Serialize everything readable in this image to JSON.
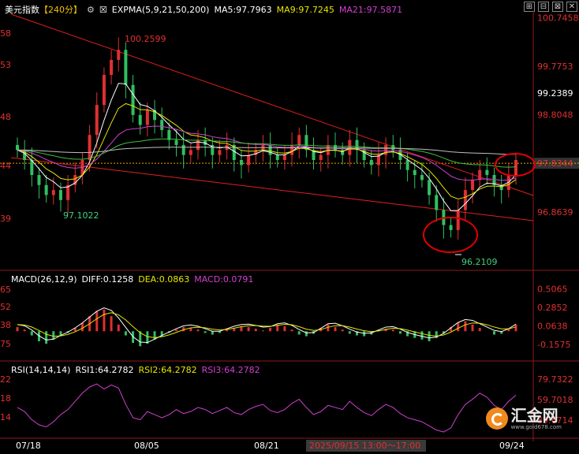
{
  "header_main": {
    "symbol": "美元指数",
    "period": "【240分】",
    "expma_label": "EXPMA(5,9,21,50,200)",
    "ma5": "MA5:97.7963",
    "ma9": "MA9:97.7245",
    "ma21": "MA21:97.5871"
  },
  "header_macd": {
    "label": "MACD(26,12,9)",
    "diff": "DIFF:0.1258",
    "dea": "DEA:0.0863",
    "macd": "MACD:0.0791"
  },
  "header_rsi": {
    "label": "RSI(14,14,14)",
    "rsi1": "RSI1:64.2782",
    "rsi2": "RSI2:64.2782",
    "rsi3": "RSI3:64.2782"
  },
  "window_buttons": [
    "⊞",
    "⊟",
    "⊠",
    "✕"
  ],
  "colors": {
    "ma5": "#ffffff",
    "ma9": "#e6e600",
    "ma21": "#d040d0",
    "ma50": "#40c040",
    "ma200": "#c0c0c0",
    "up": "#e03030",
    "down": "#30c060",
    "trend": "#e02020",
    "price_line": "#f0a000",
    "axis_text_red": "#e03030",
    "axis_text_white": "#ffffff",
    "low_label": "#40d080"
  },
  "watermark": {
    "brand": "汇金网",
    "url": "www.gold678.com"
  },
  "chart_data": [
    {
      "type": "candlestick",
      "title": "美元指数",
      "right_axis_labels": [
        "100.7458",
        "99.7753",
        "99.2389",
        "98.8048",
        "97.8344",
        "96.8639"
      ],
      "left_axis_labels": [
        "58",
        "53",
        "48",
        "44",
        "39"
      ],
      "x_labels": [
        "07/18",
        "08/05",
        "08/21",
        "2025/09/15 13:00～17:00",
        "09/24"
      ],
      "annotations": [
        {
          "text": "100.2599",
          "kind": "high"
        },
        {
          "text": "97.1022",
          "kind": "low"
        },
        {
          "text": "96.2109",
          "kind": "low"
        }
      ],
      "current_price": 97.8344,
      "ylim": [
        95.9,
        100.75
      ],
      "closes": [
        98.1,
        97.9,
        97.6,
        97.4,
        97.2,
        97.3,
        97.1,
        97.4,
        97.6,
        97.9,
        98.4,
        99.0,
        99.6,
        99.9,
        100.1,
        99.4,
        98.8,
        98.6,
        98.9,
        98.7,
        98.5,
        98.3,
        98.2,
        98.0,
        98.1,
        98.3,
        98.2,
        98.0,
        98.1,
        98.2,
        97.9,
        97.8,
        98.0,
        98.1,
        98.2,
        98.0,
        97.9,
        98.0,
        98.2,
        98.4,
        98.1,
        97.9,
        98.0,
        98.2,
        98.1,
        98.0,
        98.3,
        98.1,
        97.9,
        97.8,
        98.0,
        98.2,
        98.1,
        97.9,
        97.7,
        97.6,
        97.5,
        97.2,
        96.9,
        96.6,
        96.5,
        96.9,
        97.3,
        97.5,
        97.7,
        97.6,
        97.4,
        97.3,
        97.6,
        97.9
      ],
      "lows": {
        "first_low": 97.1022,
        "major_high": 100.2599,
        "second_low": 96.2109
      }
    },
    {
      "type": "bar",
      "title": "MACD(26,12,9)",
      "right_axis_labels": [
        "0.5065",
        "0.2852",
        "0.0638",
        "-0.1575"
      ],
      "left_axis_labels": [
        "65",
        "52",
        "38",
        "75"
      ],
      "values": [
        0.05,
        0.02,
        -0.05,
        -0.12,
        -0.15,
        -0.1,
        -0.06,
        -0.02,
        0.04,
        0.1,
        0.18,
        0.24,
        0.26,
        0.18,
        0.08,
        -0.05,
        -0.14,
        -0.18,
        -0.15,
        -0.1,
        -0.06,
        -0.02,
        0.02,
        0.05,
        0.04,
        0.02,
        -0.02,
        -0.04,
        -0.02,
        0.02,
        0.04,
        0.06,
        0.05,
        0.03,
        0.01,
        0.04,
        0.08,
        0.06,
        0.02,
        -0.04,
        -0.06,
        -0.03,
        0.04,
        0.08,
        0.05,
        0.02,
        -0.03,
        -0.05,
        -0.06,
        -0.04,
        0.01,
        0.03,
        0.02,
        -0.03,
        -0.06,
        -0.08,
        -0.1,
        -0.12,
        -0.08,
        -0.03,
        0.05,
        0.1,
        0.12,
        0.08,
        0.04,
        0.0,
        -0.04,
        -0.03,
        0.03,
        0.08
      ],
      "diff": 0.1258,
      "dea": 0.0863,
      "macd": 0.0791
    },
    {
      "type": "line",
      "title": "RSI(14,14,14)",
      "right_axis_labels": [
        "79.7322",
        "59.7018",
        "39.6714"
      ],
      "left_axis_labels": [
        "22",
        "18",
        "14"
      ],
      "values": [
        52,
        48,
        40,
        35,
        33,
        38,
        45,
        50,
        58,
        66,
        72,
        75,
        70,
        74,
        71,
        55,
        42,
        40,
        48,
        45,
        42,
        45,
        50,
        46,
        48,
        52,
        50,
        46,
        49,
        52,
        47,
        45,
        50,
        53,
        55,
        49,
        47,
        50,
        56,
        60,
        52,
        45,
        48,
        54,
        52,
        50,
        58,
        52,
        47,
        44,
        50,
        55,
        52,
        46,
        42,
        40,
        38,
        34,
        30,
        28,
        32,
        45,
        55,
        60,
        66,
        62,
        54,
        50,
        58,
        64
      ],
      "last": 64.2782
    }
  ]
}
